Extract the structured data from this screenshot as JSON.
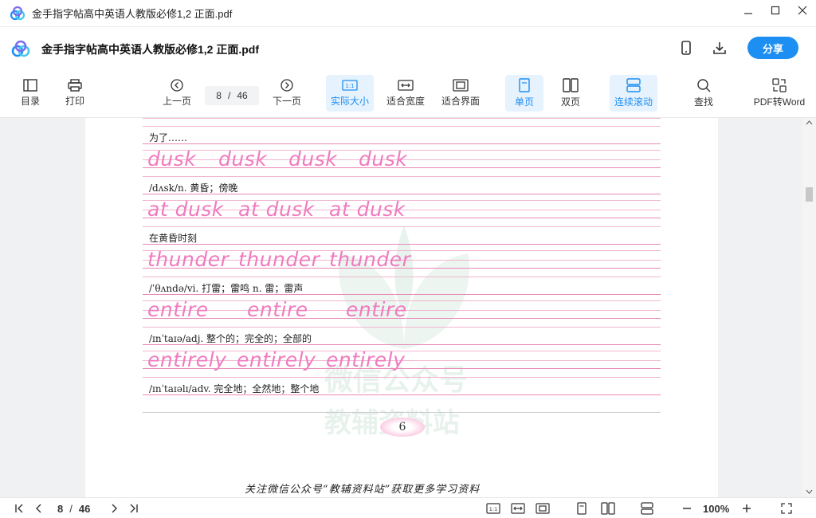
{
  "window": {
    "title": "金手指字帖高中英语人教版必修1,2 正面.pdf"
  },
  "header": {
    "doc_title": "金手指字帖高中英语人教版必修1,2 正面.pdf",
    "share_label": "分享"
  },
  "toolbar": {
    "toc": "目录",
    "print": "打印",
    "prev": "上一页",
    "next": "下一页",
    "current_page": "8",
    "sep": "/",
    "total_pages": "46",
    "actual_size": "实际大小",
    "fit_width": "适合宽度",
    "fit_page": "适合界面",
    "single": "单页",
    "double": "双页",
    "continuous": "连续滚动",
    "find": "查找",
    "pdf_to_word": "PDF转Word",
    "one_to_one": "1:1"
  },
  "document": {
    "rows": [
      {
        "cn": "为了……"
      },
      {
        "words": [
          "dusk",
          "dusk",
          "dusk",
          "dusk"
        ],
        "cn": "/dʌsk/n. 黄昏；傍晚"
      },
      {
        "words": [
          "at dusk",
          "at dusk",
          "at dusk"
        ],
        "cn": "在黄昏时刻"
      },
      {
        "words": [
          "thunder",
          "thunder",
          "thunder"
        ],
        "cn": "/ˈθʌndə/vi. 打雷；雷鸣 n. 雷；雷声"
      },
      {
        "words": [
          "entire",
          "entire",
          "entire"
        ],
        "cn": "/ɪnˈtaɪə/adj. 整个的；完全的；全部的"
      },
      {
        "words": [
          "entirely",
          "entirely",
          "entirely"
        ],
        "cn": "/ɪnˈtaɪəlɪ/adv. 完全地；全然地；整个地"
      }
    ],
    "page_number": "6",
    "footer_note": "关注微信公众号“教辅资料站”获取更多学习资料",
    "watermark_top": "微信公众号",
    "watermark_bottom": "教辅资料站"
  },
  "statusbar": {
    "current_page": "8",
    "sep": "/",
    "total_pages": "46",
    "zoom": "100%",
    "one_to_one": "1:1"
  },
  "colors": {
    "accent": "#1d8ef2",
    "pink_text": "#f07bbf",
    "pink_line": "#f1b6d0"
  },
  "icons": [
    "app-logo-icon",
    "minimize-icon",
    "maximize-icon",
    "close-icon",
    "phone-icon",
    "download-icon",
    "toc-icon",
    "print-icon",
    "prev-page-icon",
    "next-page-icon",
    "actual-size-icon",
    "fit-width-icon",
    "fit-page-icon",
    "single-page-icon",
    "double-page-icon",
    "continuous-scroll-icon",
    "search-icon",
    "pdf-to-word-icon",
    "first-page-icon",
    "last-page-icon",
    "zoom-out-icon",
    "zoom-in-icon",
    "fullscreen-icon"
  ]
}
